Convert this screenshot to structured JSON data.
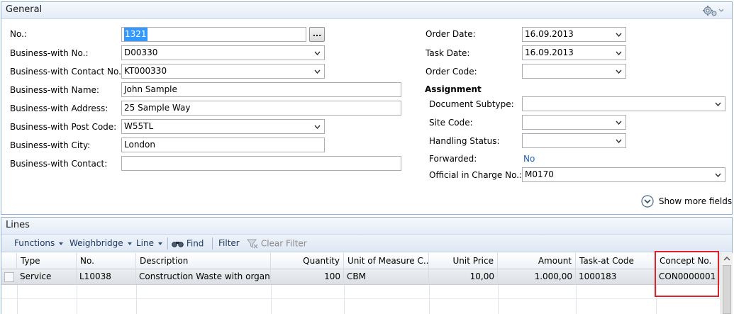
{
  "general": {
    "title": "General",
    "no_label": "No.:",
    "no_value": "1321",
    "no_button": "...",
    "business_no_label": "Business-with No.:",
    "business_no_value": "D00330",
    "contact_no_label": "Business-with Contact No.:",
    "contact_no_value": "KT000330",
    "name_label": "Business-with Name:",
    "name_value": "John Sample",
    "address_label": "Business-with Address:",
    "address_value": "25 Sample Way",
    "post_code_label": "Business-with Post Code:",
    "post_code_value": "W55TL",
    "city_label": "Business-with City:",
    "city_value": "London",
    "contact_label": "Business-with Contact:",
    "contact_value": "",
    "order_date_label": "Order Date:",
    "order_date_value": "16.09.2013",
    "task_date_label": "Task Date:",
    "task_date_value": "16.09.2013",
    "order_code_label": "Order Code:",
    "order_code_value": "",
    "assignment_label": "Assignment",
    "doc_subtype_label": "Document Subtype:",
    "doc_subtype_value": "",
    "site_code_label": "Site Code:",
    "site_code_value": "",
    "handling_status_label": "Handling Status:",
    "handling_status_value": "",
    "forwarded_label": "Forwarded:",
    "forwarded_value": "No",
    "official_label": "Official in Charge No.:",
    "official_value": "M0170",
    "show_more": "Show more fields"
  },
  "lines": {
    "title": "Lines",
    "toolbar": {
      "functions": "Functions",
      "weighbridge": "Weighbridge",
      "line": "Line",
      "find": "Find",
      "filter": "Filter",
      "clear_filter": "Clear Filter"
    },
    "columns": [
      "Type",
      "No.",
      "Description",
      "Quantity",
      "Unit of Measure C...",
      "Unit Price",
      "Amount",
      "Task-at Code",
      "Concept No."
    ],
    "rows": [
      [
        "Service",
        "L10038",
        "Construction Waste with organic...",
        "100",
        "CBM",
        "10,00",
        "1.000,00",
        "1000183",
        "CON0000001"
      ]
    ]
  },
  "colors": {
    "frame": "#8fb2d6",
    "highlight": "#d9242b",
    "selection": "#3399ff",
    "link": "#1a5fb4"
  },
  "icons": [
    "settings-gear-icon",
    "chevron-down-icon",
    "show-more-chevron-icon",
    "binoculars-icon",
    "clear-filter-icon",
    "scroll-up-icon"
  ]
}
